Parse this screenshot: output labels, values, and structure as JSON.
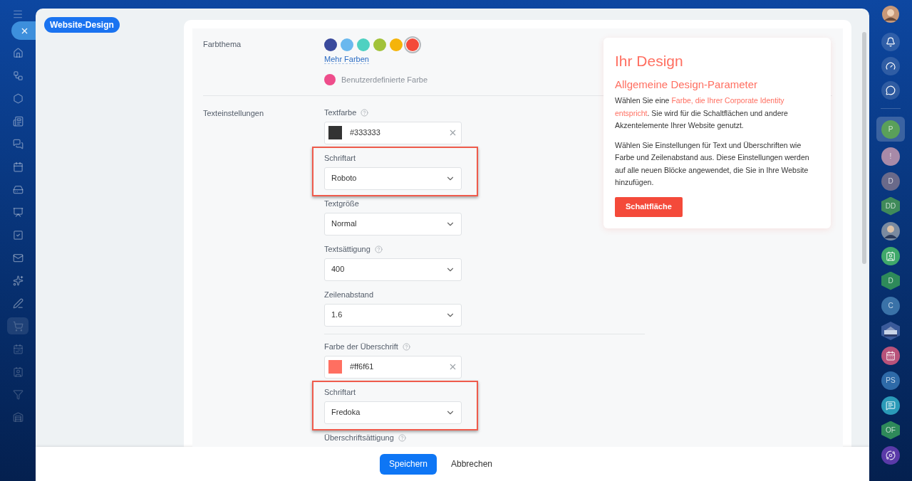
{
  "badge": "Website-Design",
  "nav": [
    {
      "selected": false
    },
    {
      "selected": false
    },
    {
      "selected": false
    },
    {
      "selected": false
    },
    {
      "selected": false
    },
    {
      "selected": false
    },
    {
      "selected": false
    },
    {
      "selected": false
    },
    {
      "selected": false
    },
    {
      "selected": false
    },
    {
      "selected": false
    },
    {
      "selected": false
    },
    {
      "selected": true
    },
    {
      "selected": false
    },
    {
      "selected": false
    },
    {
      "selected": false
    },
    {
      "selected": false
    }
  ],
  "theme": {
    "label": "Farbthema",
    "swatches": [
      {
        "color": "#3a4a9c",
        "selected": false
      },
      {
        "color": "#6ab8ee",
        "selected": false
      },
      {
        "color": "#4fd1c1",
        "selected": false
      },
      {
        "color": "#a2c23a",
        "selected": false
      },
      {
        "color": "#f5b40a",
        "selected": false
      },
      {
        "color": "#f44a3a",
        "selected": true
      }
    ],
    "more_link": "Mehr Farben",
    "custom": {
      "color": "#ee4d8b",
      "label": "Benutzerdefinierte Farbe"
    }
  },
  "text_settings": {
    "label": "Texteinstellungen",
    "fields": [
      {
        "kind": "color",
        "label": "Textfarbe",
        "help": true,
        "value": "#333333",
        "highlighted": false
      },
      {
        "kind": "select",
        "label": "Schriftart",
        "help": false,
        "value": "Roboto",
        "highlighted": true
      },
      {
        "kind": "select",
        "label": "Textgröße",
        "help": false,
        "value": "Normal",
        "highlighted": false
      },
      {
        "kind": "select",
        "label": "Textsättigung",
        "help": true,
        "value": "400",
        "highlighted": false
      },
      {
        "kind": "select",
        "label": "Zeilenabstand",
        "help": false,
        "value": "1.6",
        "highlighted": false
      },
      {
        "kind": "divider"
      },
      {
        "kind": "color",
        "label": "Farbe der Überschrift",
        "help": true,
        "value": "#ff6f61",
        "highlighted": false
      },
      {
        "kind": "select",
        "label": "Schriftart",
        "help": false,
        "value": "Fredoka",
        "highlighted": true
      },
      {
        "kind": "select",
        "label": "Überschriftsättigung",
        "help": true,
        "highlighted": false
      }
    ]
  },
  "preview": {
    "title": "Ihr Design",
    "subtitle": "Allgemeine Design-Parameter",
    "paragraphs": [
      [
        {
          "text": "Wählen Sie eine "
        },
        {
          "text": "Farbe, die Ihrer Corporate Identity entspricht",
          "kind": "accent"
        },
        {
          "text": ". Sie wird für die Schaltflächen und andere Akzentelemente Ihrer Website genutzt."
        }
      ],
      [
        {
          "text": "Wählen Sie Einstellungen für Text und Überschriften wie Farbe und Zeilenabstand aus. Diese Einstellungen werden auf alle neuen Blöcke angewendet, die Sie in Ihre Website hinzufügen."
        }
      ]
    ],
    "button": "Schaltfläche"
  },
  "footer": {
    "save": "Speichern",
    "cancel": "Abbrechen"
  },
  "right_bar": [
    {
      "kind": "icon"
    },
    {
      "kind": "icon"
    },
    {
      "kind": "icon"
    },
    {
      "kind": "divider"
    },
    {
      "kind": "letter",
      "text": "P",
      "color": "#5aa05a",
      "selected": true
    },
    {
      "kind": "letter",
      "text": "!",
      "color": "#a88aa8",
      "selected": false
    },
    {
      "kind": "letter",
      "text": "D",
      "color": "#6a6a8a",
      "selected": false
    },
    {
      "kind": "hex",
      "text": "DD",
      "color": "#3f8a5a",
      "selected": false
    },
    {
      "kind": "person",
      "selected": false
    },
    {
      "kind": "icon",
      "color": "#3fa86a",
      "selected": false
    },
    {
      "kind": "hex",
      "text": "D",
      "color": "#2e8a5a",
      "selected": false
    },
    {
      "kind": "letter",
      "text": "C",
      "color": "#3a72a8",
      "selected": false
    },
    {
      "kind": "picture",
      "selected": false
    },
    {
      "kind": "icon",
      "color": "#b8527a",
      "selected": false
    },
    {
      "kind": "letter",
      "text": "PS",
      "color": "#2e6aa8",
      "selected": false
    },
    {
      "kind": "icon",
      "color": "#2a9ab8",
      "selected": false
    },
    {
      "kind": "hex",
      "text": "OF",
      "color": "#2e8a5a",
      "selected": false
    },
    {
      "kind": "icon",
      "color": "#5a3aa8",
      "selected": false
    }
  ]
}
